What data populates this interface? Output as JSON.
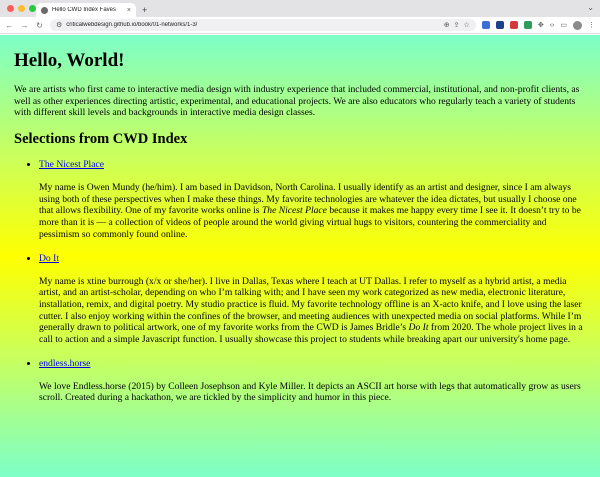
{
  "browser": {
    "tab_title": "Hello CWD Index Faves",
    "tab_close": "×",
    "new_tab": "+",
    "tab_menu": "⌄",
    "url": "criticalwebdesign.github.io/book/01-networks/1-3/"
  },
  "page": {
    "heading": "Hello, World!",
    "intro": "We are artists who first came to interactive media design with industry experience that included commercial, institutional, and non-profit clients, as well as other experiences directing artistic, experimental, and educational projects. We are also educators who regularly teach a variety of students with different skill levels and backgrounds in interactive media design classes.",
    "section_heading": "Selections from CWD Index",
    "items": [
      {
        "link": "The Nicest Place",
        "text_before": "My name is Owen Mundy (he/him). I am based in Davidson, North Carolina. I usually identify as an artist and designer, since I am always using both of these perspectives when I make these things. My favorite technologies are whatever the idea dictates, but usually I choose one that allows flexibility. One of my favorite works online is ",
        "emph": "The Nicest Place",
        "text_after": " because it makes me happy every time I see it. It doesn’t try to be more than it is — a collection of videos of people around the world giving virtual hugs to visitors, countering the commerciality and pessimism so commonly found online."
      },
      {
        "link": "Do It",
        "text_before": "My name is xtine burrough (x/x or she/her). I live in Dallas, Texas where I teach at UT Dallas. I refer to myself as a hybrid artist, a media artist, and an artist-scholar, depending on who I’m talking with; and I have seen my work categorized as new media, electronic literature, installation, remix, and digital poetry. My studio practice is fluid. My favorite technology offline is an X-acto knife, and I love using the laser cutter. I also enjoy working within the confines of the browser, and meeting audiences with unexpected media on social platforms. While I’m generally drawn to political artwork, one of my favorite works from the CWD is James Bridle’s ",
        "emph": "Do It",
        "text_after": " from 2020. The whole project lives in a call to action and a simple Javascript function. I usually showcase this project to students while breaking apart our university's home page."
      },
      {
        "link": "endless.horse",
        "text_before": "We love Endless.horse (2015) by Colleen Josephson and Kyle Miller. It depicts an ASCII art horse with legs that automatically grow as users scroll. Created during a hackathon, we are tickled by the simplicity and humor in this piece.",
        "emph": "",
        "text_after": ""
      }
    ]
  }
}
